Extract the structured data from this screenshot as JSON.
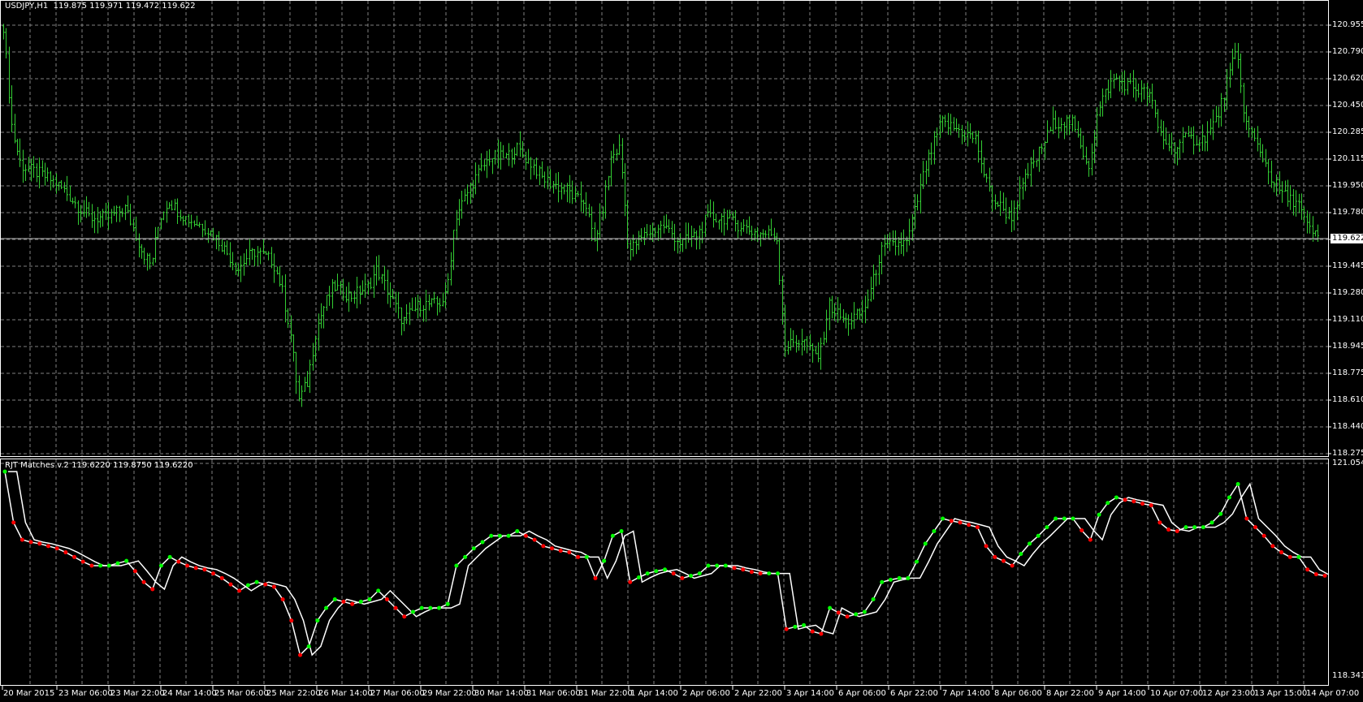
{
  "main_window": {
    "symbol": "USDJPY,H1",
    "ohlc": "119.875 119.971 119.472 119.622",
    "current_price": "119.622",
    "price_labels": [
      "120.955",
      "120.790",
      "120.620",
      "120.450",
      "120.285",
      "120.115",
      "119.950",
      "119.780",
      "",
      "119.445",
      "119.280",
      "119.110",
      "118.945",
      "118.775",
      "118.610",
      "118.440",
      "118.275"
    ]
  },
  "indicator_window": {
    "title": "RJT Matches v.2 119.6220 119.8750 119.6220",
    "max_label": "121.0543",
    "min_label": "118.3417"
  },
  "time_axis": [
    "20 Mar 2015",
    "23 Mar 06:00",
    "23 Mar 22:00",
    "24 Mar 14:00",
    "25 Mar 06:00",
    "25 Mar 22:00",
    "26 Mar 14:00",
    "27 Mar 06:00",
    "29 Mar 22:00",
    "30 Mar 14:00",
    "31 Mar 06:00",
    "31 Mar 22:00",
    "1 Apr 14:00",
    "2 Apr 06:00",
    "2 Apr 22:00",
    "3 Apr 14:00",
    "6 Apr 06:00",
    "6 Apr 22:00",
    "7 Apr 14:00",
    "8 Apr 06:00",
    "8 Apr 22:00",
    "9 Apr 14:00",
    "10 Apr 07:00",
    "12 Apr 23:00",
    "13 Apr 15:00",
    "14 Apr 07:00"
  ],
  "colors": {
    "bars": "#33cc33",
    "grid": "#808080",
    "price_line": "#c0c0c0",
    "rise_dot": "#00ff00",
    "fall_dot": "#ff0000",
    "indicator_line": "#ffffff"
  },
  "chart_data": {
    "type": "bar",
    "description_of_series": "approximate close prices sampled evenly across the visible range",
    "ylim_main": [
      118.275,
      120.955
    ],
    "ylim_indicator": [
      118.3417,
      121.0543
    ],
    "closes": [
      120.95,
      120.3,
      120.08,
      120.05,
      120.03,
      120.0,
      119.97,
      119.92,
      119.86,
      119.8,
      119.75,
      119.75,
      119.75,
      119.78,
      119.81,
      119.68,
      119.54,
      119.45,
      119.75,
      119.86,
      119.8,
      119.75,
      119.72,
      119.7,
      119.65,
      119.59,
      119.51,
      119.43,
      119.5,
      119.54,
      119.51,
      119.48,
      119.32,
      119.05,
      118.61,
      118.72,
      119.05,
      119.21,
      119.32,
      119.29,
      119.26,
      119.29,
      119.32,
      119.43,
      119.32,
      119.21,
      119.1,
      119.16,
      119.21,
      119.21,
      119.21,
      119.26,
      119.75,
      119.86,
      119.97,
      120.05,
      120.13,
      120.13,
      120.13,
      120.19,
      120.13,
      120.08,
      120.0,
      119.97,
      119.94,
      119.92,
      119.86,
      119.86,
      119.59,
      119.81,
      120.13,
      120.19,
      119.54,
      119.6,
      119.65,
      119.68,
      119.7,
      119.65,
      119.59,
      119.62,
      119.65,
      119.75,
      119.75,
      119.75,
      119.72,
      119.7,
      119.67,
      119.65,
      119.65,
      119.65,
      118.94,
      118.97,
      118.99,
      118.91,
      118.88,
      119.21,
      119.15,
      119.1,
      119.13,
      119.16,
      119.32,
      119.54,
      119.57,
      119.59,
      119.59,
      119.8,
      120.03,
      120.19,
      120.35,
      120.32,
      120.3,
      120.27,
      120.24,
      120.0,
      119.86,
      119.81,
      119.75,
      119.9,
      120.03,
      120.13,
      120.24,
      120.35,
      120.35,
      120.35,
      120.2,
      120.08,
      120.4,
      120.55,
      120.62,
      120.59,
      120.57,
      120.54,
      120.52,
      120.3,
      120.21,
      120.19,
      120.24,
      120.24,
      120.24,
      120.3,
      120.41,
      120.62,
      120.79,
      120.35,
      120.24,
      120.13,
      120.0,
      119.92,
      119.86,
      119.86,
      119.7,
      119.64,
      119.622
    ]
  }
}
